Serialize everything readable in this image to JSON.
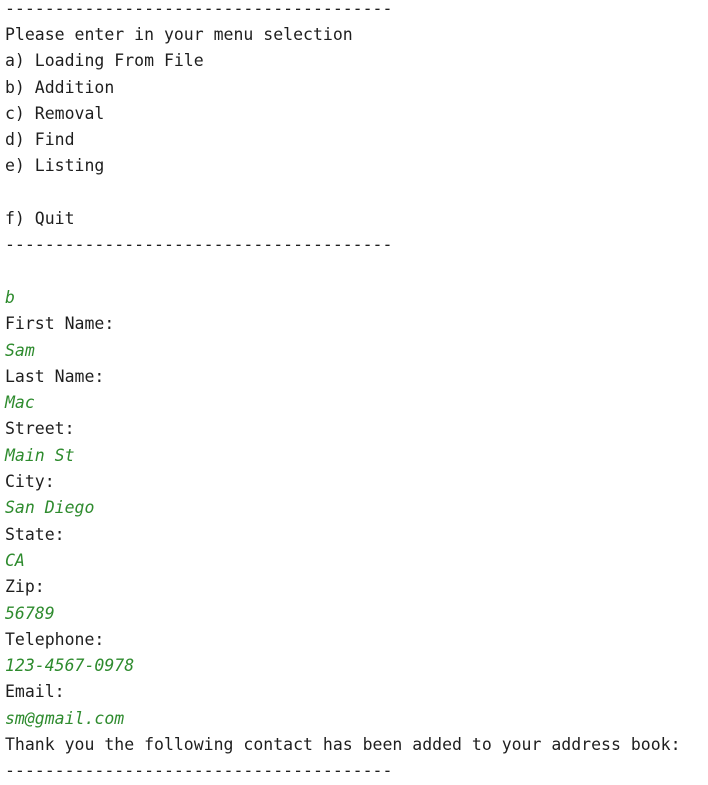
{
  "console": {
    "separator": "---------------------------------------",
    "menu": {
      "prompt": "Please enter in your menu selection",
      "options": [
        "a) Loading From File",
        "b) Addition",
        "c) Removal",
        "d) Find",
        "e) Listing",
        "f) Quit"
      ]
    },
    "session": {
      "selection": "b",
      "first_name_label": "First Name:",
      "first_name_value": "Sam",
      "last_name_label": "Last Name:",
      "last_name_value": "Mac",
      "street_label": "Street:",
      "street_value": "Main St",
      "city_label": "City:",
      "city_value": "San Diego",
      "state_label": "State:",
      "state_value": "CA",
      "zip_label": "Zip:",
      "zip_value": "56789",
      "telephone_label": "Telephone:",
      "telephone_value": "123-4567-0978",
      "email_label": "Email:",
      "email_value": "sm@gmail.com",
      "confirmation": "Thank you the following contact has been added to your address book:"
    },
    "colors": {
      "output_text": "#1e1e1e",
      "user_input_text": "#2e8b2e",
      "background": "#ffffff"
    }
  }
}
